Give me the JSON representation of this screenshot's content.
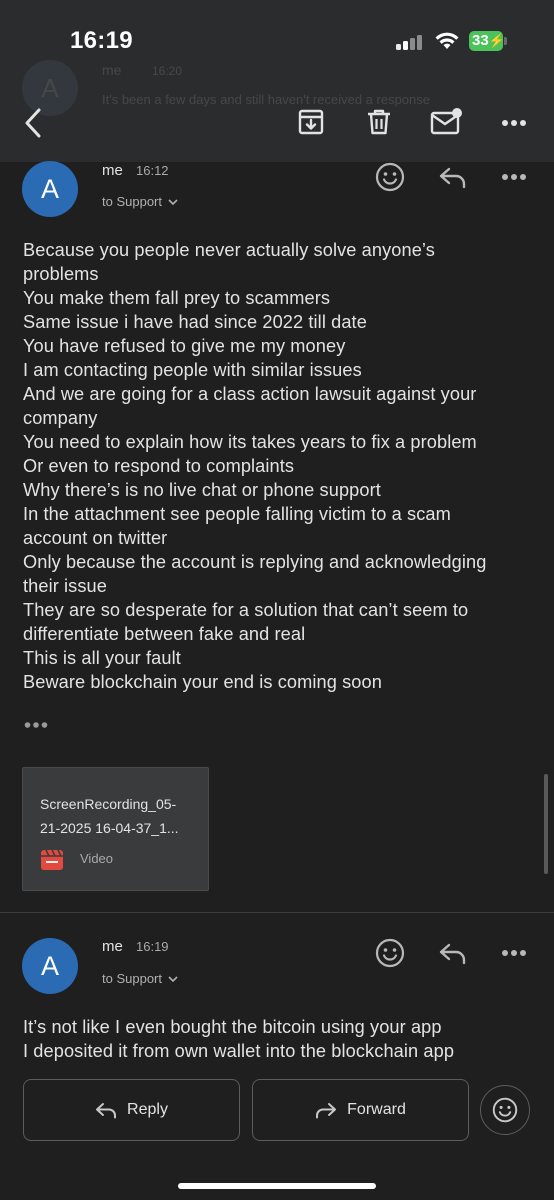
{
  "status_bar": {
    "time": "16:19",
    "battery": "33"
  },
  "background_preview": {
    "avatar_letter": "A",
    "sender": "me",
    "time": "16:20",
    "snippet": "It's been a few days and still haven't received a response"
  },
  "toolbar": {
    "back_icon": "chevron-left-icon",
    "archive_icon": "archive-icon",
    "delete_icon": "trash-icon",
    "mark_unread_icon": "mail-unread-icon",
    "more_icon": "more-horizontal-icon"
  },
  "messages": [
    {
      "avatar_letter": "A",
      "sender": "me",
      "time": "16:12",
      "recipient": "to Support",
      "body_lines": [
        "Because you people never actually solve anyone’s",
        "problems",
        "You make them fall prey to scammers",
        "Same issue i have had since 2022 till date",
        "You have refused to give me my money",
        "I am contacting people with similar issues",
        "And we are going for a class action lawsuit against your",
        "company",
        "You need to explain how its takes years to fix a problem",
        "Or even to respond to complaints",
        "Why there’s is no live chat or phone support",
        "In the attachment see people falling victim to a scam",
        "account on twitter",
        "Only because the account is replying and acknowledging",
        "their issue",
        "They are so desperate for a solution that can’t seem to",
        "differentiate between fake and real",
        "This is all your fault",
        "Beware blockchain your end is coming soon"
      ],
      "attachment": {
        "name_line1": "ScreenRecording_05-",
        "name_line2": "21-2025 16-04-37_1...",
        "type": "Video"
      }
    },
    {
      "avatar_letter": "A",
      "sender": "me",
      "time": "16:19",
      "recipient": "to Support",
      "body_lines": [
        "It’s not like I even bought the bitcoin using your app",
        "I deposited it from own wallet into the blockchain app"
      ]
    }
  ],
  "actions": {
    "reply": "Reply",
    "forward": "Forward"
  },
  "colors": {
    "avatar": "#2a6bb4",
    "background": "#1f1f20",
    "battery": "#4cc35a",
    "attachment_icon": "#e04a3f"
  }
}
